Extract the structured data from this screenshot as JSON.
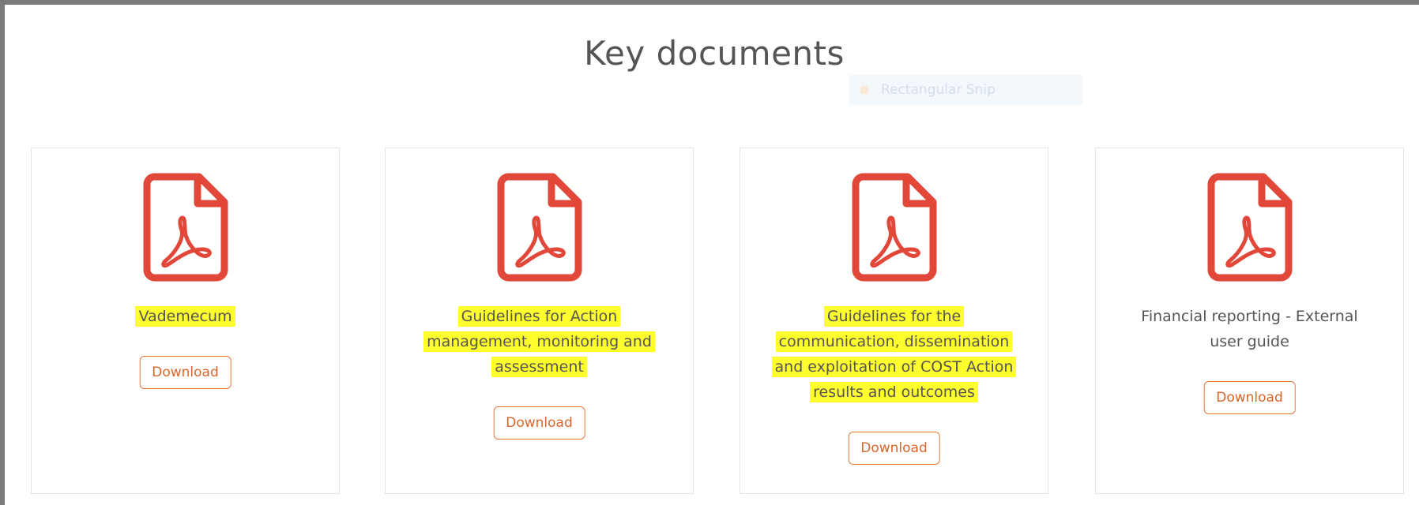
{
  "page": {
    "title": "Key documents"
  },
  "overlay": {
    "snip_label": "Rectangular Snip"
  },
  "documents": [
    {
      "title_lines": [
        "Vademecum"
      ],
      "highlighted": true,
      "button_label": "Download",
      "icon": "pdf-file-icon"
    },
    {
      "title_lines": [
        "Guidelines for Action",
        "management, monitoring and",
        "assessment"
      ],
      "highlighted": true,
      "button_label": "Download",
      "icon": "pdf-file-icon"
    },
    {
      "title_lines": [
        "Guidelines for the",
        "communication, dissemination",
        "and exploitation of COST Action",
        "results and outcomes"
      ],
      "highlighted": true,
      "button_label": "Download",
      "icon": "pdf-file-icon"
    },
    {
      "title_lines": [
        "Financial reporting - External",
        "user guide"
      ],
      "highlighted": false,
      "button_label": "Download",
      "icon": "pdf-file-icon"
    }
  ],
  "colors": {
    "icon_red": "#e2483a",
    "highlight_yellow": "#ffff2e",
    "button_orange": "#d9652a",
    "text_gray": "#555555"
  }
}
